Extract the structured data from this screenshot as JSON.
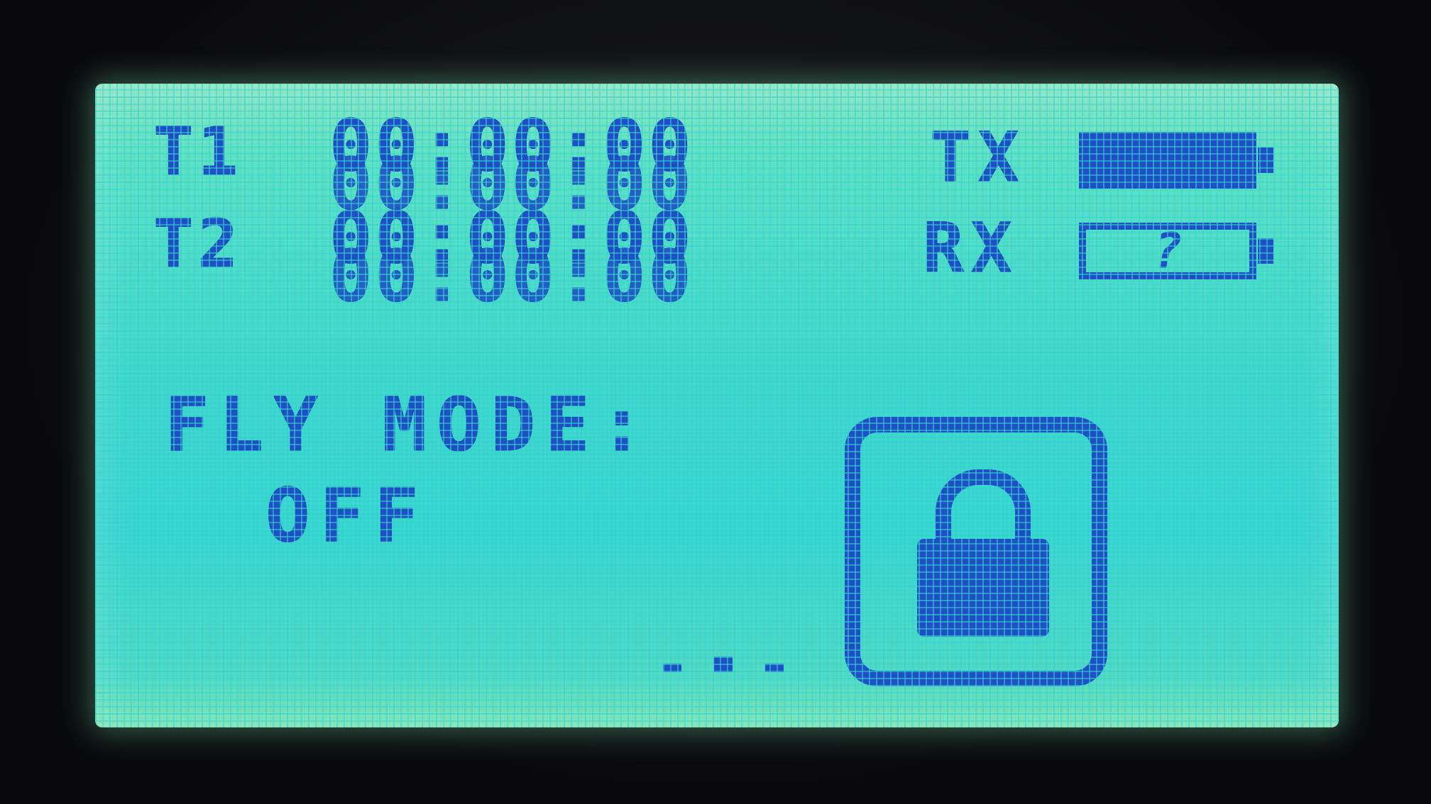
{
  "timers": [
    {
      "label": "T1",
      "value": "00:00:00"
    },
    {
      "label": "T2",
      "value": "00:00:00"
    }
  ],
  "transmitter": {
    "label": "TX",
    "battery_level": 1.0
  },
  "receiver": {
    "label": "RX",
    "battery_text": "?"
  },
  "fly_mode": {
    "label": "FLY MODE:",
    "value": "OFF"
  },
  "lock": {
    "icon": "lock-icon",
    "state": "locked"
  },
  "colors": {
    "segment": "#1f52c8",
    "screen_background": "#38d7d2",
    "bezel": "#0c0c0e"
  }
}
